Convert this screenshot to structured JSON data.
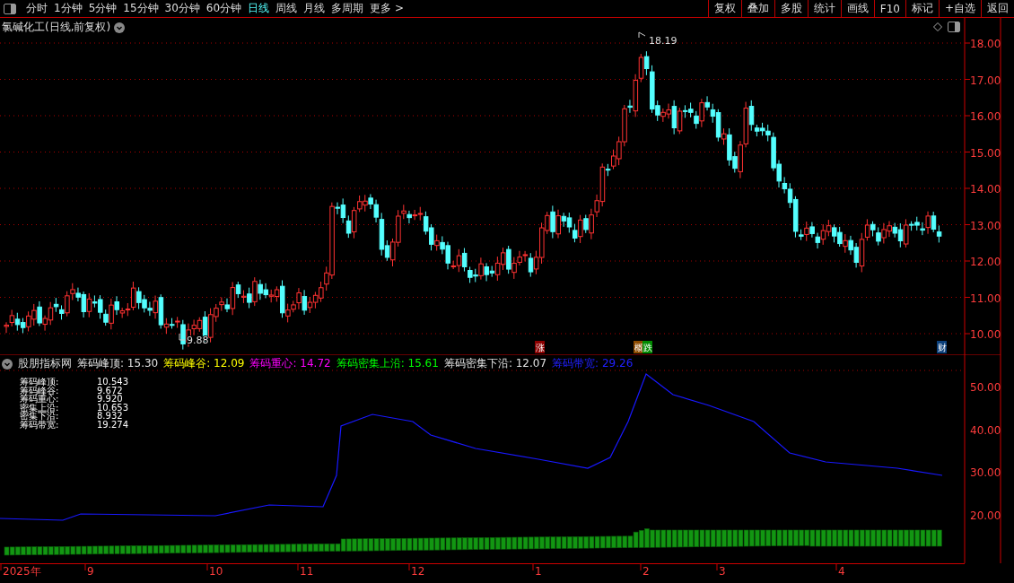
{
  "toolbar": {
    "periods": [
      {
        "label": "分时",
        "selected": false
      },
      {
        "label": "1分钟",
        "selected": false
      },
      {
        "label": "5分钟",
        "selected": false
      },
      {
        "label": "15分钟",
        "selected": false
      },
      {
        "label": "30分钟",
        "selected": false
      },
      {
        "label": "60分钟",
        "selected": false
      },
      {
        "label": "日线",
        "selected": true
      },
      {
        "label": "周线",
        "selected": false
      },
      {
        "label": "月线",
        "selected": false
      },
      {
        "label": "多周期",
        "selected": false
      },
      {
        "label": "更多 >",
        "selected": false
      }
    ],
    "buttons": [
      "复权",
      "叠加",
      "多股",
      "统计",
      "画线",
      "F10",
      "标记",
      "+自选",
      "返回"
    ]
  },
  "main_chart": {
    "title": "氯碱化工(日线,前复权)",
    "high_label": "18.19",
    "low_label": "9.88",
    "y_ticks": [
      "18.00",
      "17.00",
      "16.00",
      "15.00",
      "14.00",
      "13.00",
      "12.00",
      "11.00",
      "10.00"
    ],
    "markers": [
      {
        "text": "涨",
        "color": "#8b0000"
      },
      {
        "text": "概",
        "color": "#8b4a00"
      },
      {
        "text": "跌",
        "color": "#008a00"
      },
      {
        "text": "财",
        "color": "#0b3f7a"
      }
    ]
  },
  "indicator": {
    "name": "股朋指标网",
    "readings": [
      {
        "label": "筹码峰顶:",
        "value": "15.30",
        "color": "#e0e0e0"
      },
      {
        "label": "筹码峰谷:",
        "value": "12.09",
        "color": "#ffff00"
      },
      {
        "label": "筹码重心:",
        "value": "14.72",
        "color": "#ff00ff"
      },
      {
        "label": "筹码密集上沿:",
        "value": "15.61",
        "color": "#00ff00"
      },
      {
        "label": "筹码密集下沿:",
        "value": "12.07",
        "color": "#e0e0e0"
      },
      {
        "label": "筹码带宽:",
        "value": "29.26",
        "color": "#2020ff"
      }
    ],
    "legend": [
      {
        "label": "筹码峰顶:",
        "value": "10.543"
      },
      {
        "label": "筹码峰谷:",
        "value": "9.672"
      },
      {
        "label": "筹码重心:",
        "value": "9.920"
      },
      {
        "label": "密集上沿:",
        "value": "10.653"
      },
      {
        "label": "密集下沿:",
        "value": "8.932"
      },
      {
        "label": "筹码带宽:",
        "value": "19.274"
      }
    ],
    "y_ticks": [
      "50.00",
      "40.00",
      "30.00",
      "20.00"
    ]
  },
  "date_axis": [
    "2025年",
    "9",
    "10",
    "11",
    "12",
    "1",
    "2",
    "3",
    "4"
  ]
}
